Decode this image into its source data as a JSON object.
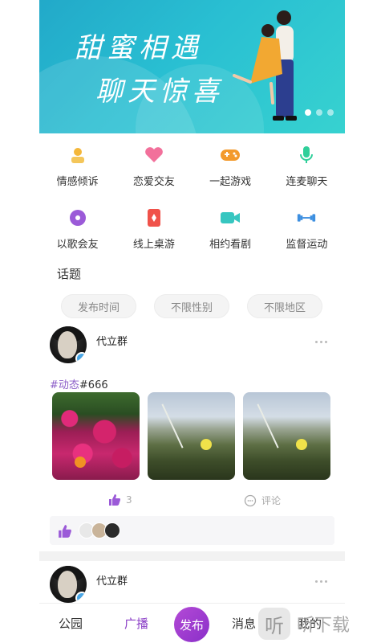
{
  "banner": {
    "line1": "甜蜜相遇",
    "line2": "聊天惊喜",
    "dots": 3,
    "active_dot": 0
  },
  "categories": [
    {
      "label": "情感倾诉",
      "icon": "person-icon",
      "color": "#f4b73a"
    },
    {
      "label": "恋爱交友",
      "icon": "heart-icon",
      "color": "#f2709b"
    },
    {
      "label": "一起游戏",
      "icon": "gamepad-icon",
      "color": "#f39a2c"
    },
    {
      "label": "连麦聊天",
      "icon": "microphone-icon",
      "color": "#2fcf9a"
    },
    {
      "label": "以歌会友",
      "icon": "music-disc-icon",
      "color": "#9b5ad8"
    },
    {
      "label": "线上桌游",
      "icon": "card-icon",
      "color": "#f0524a"
    },
    {
      "label": "相约看剧",
      "icon": "video-camera-icon",
      "color": "#36c6c0"
    },
    {
      "label": "监督运动",
      "icon": "dumbbell-icon",
      "color": "#3d8fe0"
    }
  ],
  "topics": {
    "title": "话题",
    "filters": [
      "发布时间",
      "不限性别",
      "不限地区"
    ]
  },
  "posts": [
    {
      "username": "代立群",
      "tag": "#动态",
      "hashtag": "#666",
      "likes": "3",
      "comment_label": "评论"
    },
    {
      "username": "代立群"
    }
  ],
  "nav": {
    "items": [
      "公园",
      "广播",
      "发布",
      "消息",
      "我的"
    ],
    "active": "广播",
    "accent": "#8b3fc7"
  },
  "watermark": {
    "logo_char": "听",
    "text": "听下载"
  }
}
